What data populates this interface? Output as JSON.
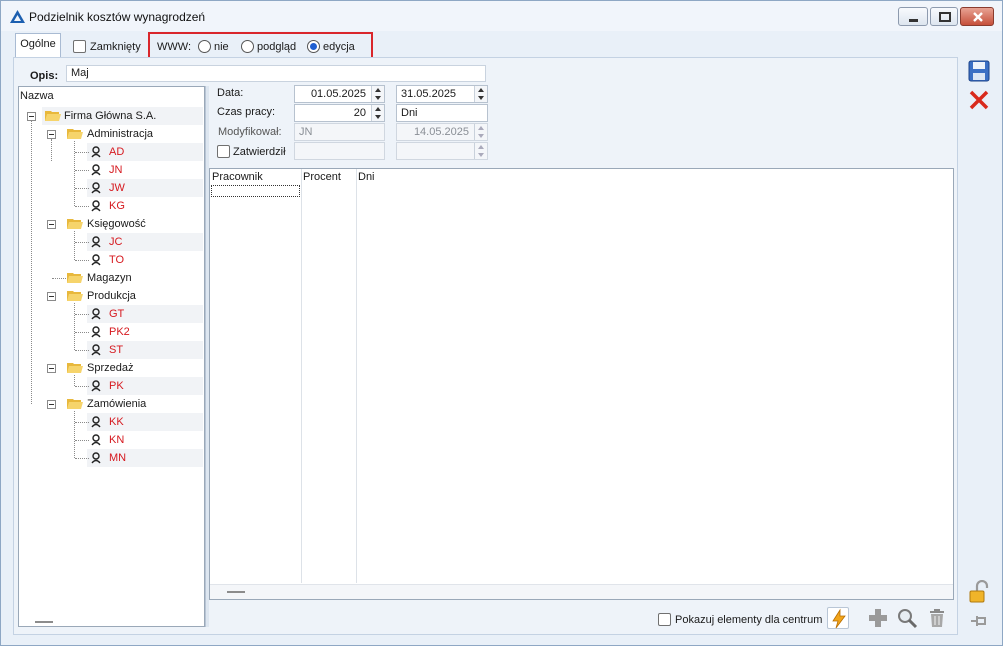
{
  "window": {
    "title": "Podzielnik kosztów wynagrodzeń"
  },
  "tabs": [
    {
      "label": "Ogólne",
      "active": true
    }
  ],
  "header": {
    "closed_label": "Zamknięty",
    "closed_checked": false,
    "www_label": "WWW:",
    "www_options": [
      {
        "label": "nie",
        "selected": false
      },
      {
        "label": "podgląd",
        "selected": false
      },
      {
        "label": "edycja",
        "selected": true
      }
    ]
  },
  "opis": {
    "label": "Opis:",
    "value": "Maj"
  },
  "tree": {
    "header": "Nazwa",
    "root": "Firma Główna S.A.",
    "nodes": [
      {
        "label": "Administracja",
        "children": [
          "AD",
          "JN",
          "JW",
          "KG"
        ]
      },
      {
        "label": "Księgowość",
        "children": [
          "JC",
          "TO"
        ]
      },
      {
        "label": "Magazyn",
        "children": []
      },
      {
        "label": "Produkcja",
        "children": [
          "GT",
          "PK2",
          "ST"
        ]
      },
      {
        "label": "Sprzedaż",
        "children": [
          "PK"
        ]
      },
      {
        "label": "Zamówienia",
        "children": [
          "KK",
          "KN",
          "MN"
        ]
      }
    ]
  },
  "form": {
    "data_label": "Data:",
    "date_from": "01.05.2025",
    "date_to": "31.05.2025",
    "czas_label": "Czas pracy:",
    "czas_value": "20",
    "czas_unit": "Dni",
    "modified_label": "Modyfikował:",
    "modified_by": "JN",
    "modified_date": "14.05.2025",
    "approved_label": "Zatwierdził",
    "approved_checked": false,
    "approved_by": "",
    "approved_date": ""
  },
  "grid": {
    "columns": [
      "Pracownik",
      "Procent",
      "Dni"
    ],
    "rows": []
  },
  "footer": {
    "show_elements_label": "Pokazuj elementy dla centrum",
    "show_elements_checked": false
  },
  "colors": {
    "accent": "#1f5fd1",
    "highlight_border": "#d9262b",
    "employee_text": "#d6191f"
  }
}
